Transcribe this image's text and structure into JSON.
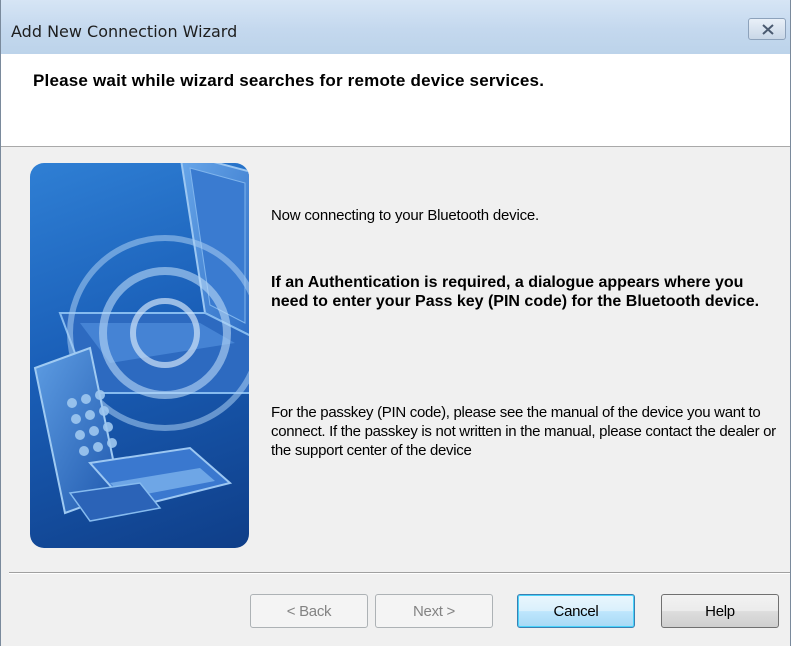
{
  "window": {
    "title": "Add New Connection Wizard"
  },
  "header": {
    "instruction": "Please wait while wizard searches for remote device services."
  },
  "content": {
    "connecting_text": "Now connecting to your Bluetooth device.",
    "auth_text": "If an Authentication is required, a dialogue appears where you need to enter your Pass key (PIN code) for the Bluetooth device.",
    "passkey_text": "For the passkey (PIN code), please see the manual of the device you want to connect. If the passkey is not written in the manual, please contact the dealer or the support center of the device"
  },
  "buttons": {
    "back": "< Back",
    "next": "Next >",
    "cancel": "Cancel",
    "help": "Help"
  },
  "icons": {
    "close": "close-icon",
    "illustration": "bluetooth-devices-illustration"
  },
  "colors": {
    "titlebar": "#c4d8ee",
    "illustration_blue": "#1a5fb8",
    "default_button_border": "#3c7fb1"
  }
}
